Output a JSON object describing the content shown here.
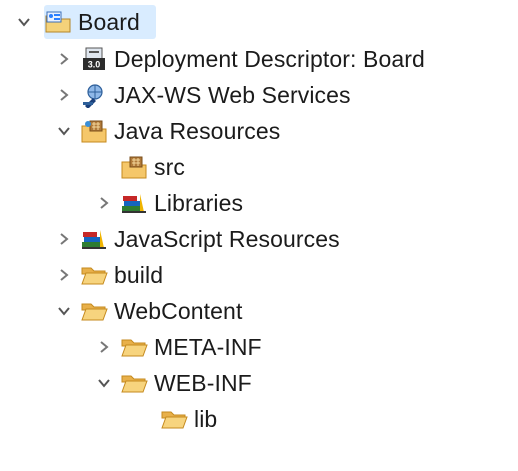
{
  "tree": {
    "items": [
      {
        "label": "Board",
        "icon": "project-icon",
        "state": "expanded"
      },
      {
        "label": "Deployment Descriptor: Board",
        "icon": "deployment-descriptor-icon",
        "state": "collapsed"
      },
      {
        "label": "JAX-WS Web Services",
        "icon": "web-services-icon",
        "state": "collapsed"
      },
      {
        "label": "Java Resources",
        "icon": "java-resources-icon",
        "state": "expanded"
      },
      {
        "label": "src",
        "icon": "source-folder-icon",
        "state": "leaf"
      },
      {
        "label": "Libraries",
        "icon": "libraries-icon",
        "state": "collapsed"
      },
      {
        "label": "JavaScript Resources",
        "icon": "libraries-icon",
        "state": "collapsed"
      },
      {
        "label": "build",
        "icon": "folder-icon",
        "state": "collapsed"
      },
      {
        "label": "WebContent",
        "icon": "folder-icon",
        "state": "expanded"
      },
      {
        "label": "META-INF",
        "icon": "folder-icon",
        "state": "collapsed"
      },
      {
        "label": "WEB-INF",
        "icon": "folder-icon",
        "state": "expanded"
      },
      {
        "label": "lib",
        "icon": "folder-icon",
        "state": "leaf"
      }
    ]
  },
  "colors": {
    "selection": "#d9ecff",
    "folder": "#f5c76a",
    "folder_outline": "#c58a1e",
    "chevron": "#555555"
  }
}
